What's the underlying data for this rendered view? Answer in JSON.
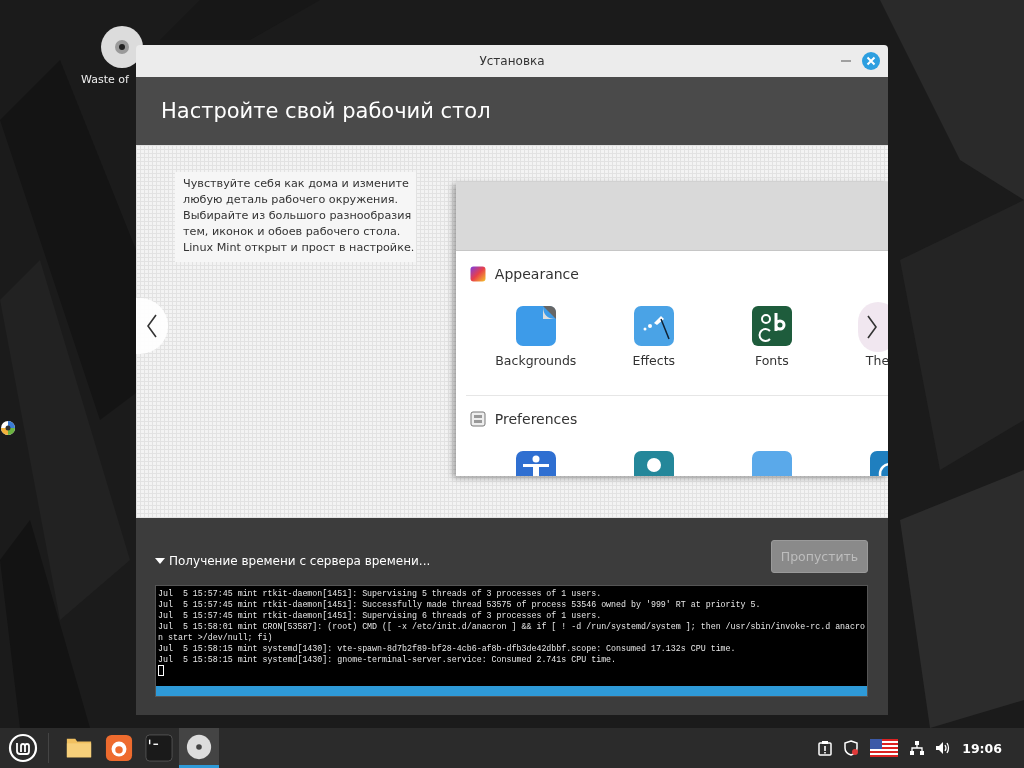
{
  "desktop": {
    "icons": [
      {
        "label": "Waste of"
      }
    ]
  },
  "window": {
    "title": "Установка",
    "heading": "Настройте свой рабочий стол",
    "description": "Чувствуйте себя как дома и измените любую деталь рабочего окружения. Выбирайте из большого разнообразия тем, иконок и обоев рабочего стола. Linux Mint открыт и прост в настройке.",
    "sections": [
      {
        "title": "Appearance",
        "kind": "appearance",
        "items": [
          {
            "label": "Backgrounds",
            "kind": "backgrounds"
          },
          {
            "label": "Effects",
            "kind": "effects"
          },
          {
            "label": "Fonts",
            "kind": "fonts"
          },
          {
            "label": "The"
          }
        ]
      },
      {
        "title": "Preferences",
        "kind": "preferences",
        "items": [
          {
            "kind": "accessibility"
          },
          {
            "kind": "account"
          },
          {
            "kind": "blank"
          },
          {
            "kind": "clock"
          }
        ]
      }
    ],
    "status": {
      "text": "Получение времени с сервера времени...",
      "expanded": true
    },
    "skip_button": {
      "label": "Пропустить",
      "disabled": true
    },
    "log": [
      "Jul  5 15:57:45 mint rtkit-daemon[1451]: Supervising 5 threads of 3 processes of 1 users.",
      "Jul  5 15:57:45 mint rtkit-daemon[1451]: Successfully made thread 53575 of process 53546 owned by '999' RT at priority 5.",
      "Jul  5 15:57:45 mint rtkit-daemon[1451]: Supervising 6 threads of 3 processes of 1 users.",
      "Jul  5 15:58:01 mint CRON[53587]: (root) CMD ([ -x /etc/init.d/anacron ] && if [ ! -d /run/systemd/system ]; then /usr/sbin/invoke-rc.d anacron start >/dev/null; fi)",
      "Jul  5 15:58:15 mint systemd[1430]: vte-spawn-8d7b2f89-bf28-4cb6-af8b-dfb3de42dbbf.scope: Consumed 17.132s CPU time.",
      "Jul  5 15:58:15 mint systemd[1430]: gnome-terminal-server.service: Consumed 2.741s CPU time."
    ],
    "progress": {
      "level": 1
    }
  },
  "taskbar": {
    "apps": [
      {
        "kind": "files",
        "selected": false
      },
      {
        "kind": "browser",
        "selected": false
      },
      {
        "kind": "terminal",
        "selected": false
      },
      {
        "kind": "disc",
        "selected": true
      }
    ],
    "clock": "19:06"
  }
}
